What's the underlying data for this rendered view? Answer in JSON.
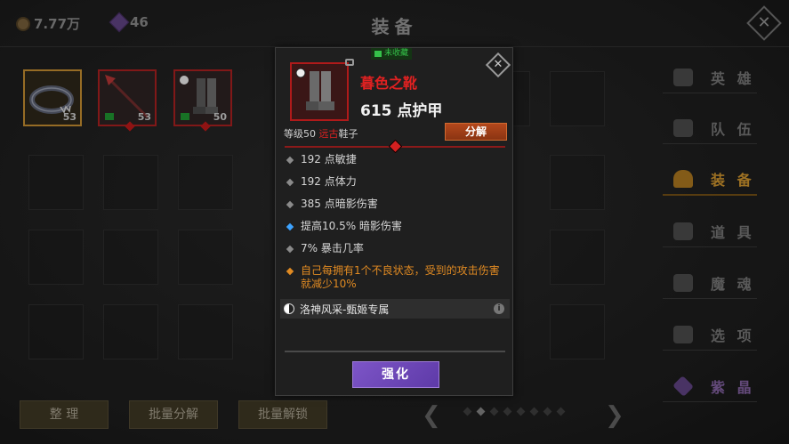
{
  "header": {
    "gold": "7.77万",
    "gems": "46",
    "title": "装备"
  },
  "inventory": {
    "items": [
      {
        "name": "dark-collar",
        "level": "53"
      },
      {
        "name": "spear",
        "level": "53"
      },
      {
        "name": "dusk-boots",
        "level": "50"
      }
    ]
  },
  "bottom_bar": {
    "sort_label": "整 理",
    "batch_salvage_label": "批量分解",
    "batch_unlock_label": "批量解锁",
    "prev_arrow": "❮",
    "next_arrow": "❯",
    "page_count": 8,
    "current_page": 2
  },
  "sidebar": {
    "items": [
      {
        "label": "英 雄",
        "icon": "hero-icon"
      },
      {
        "label": "队 伍",
        "icon": "flag-icon"
      },
      {
        "label": "装 备",
        "icon": "helmet-icon"
      },
      {
        "label": "道 具",
        "icon": "bag-icon"
      },
      {
        "label": "魔 魂",
        "icon": "flame-icon"
      },
      {
        "label": "选 项",
        "icon": "gear-icon"
      },
      {
        "label": "紫 晶",
        "icon": "crystal-icon"
      }
    ],
    "active": 2
  },
  "tooltip": {
    "uncollected_badge": "未收藏",
    "item_name": "暮色之靴",
    "armor": "615 点护甲",
    "level_text": "等级50 ",
    "quality": "远古",
    "slot_type": "鞋子",
    "salvage_label": "分解",
    "stats": [
      "192 点敏捷",
      "192 点体力",
      "385 点暗影伤害",
      "提高10.5% 暗影伤害",
      "7% 暴击几率",
      "自己每拥有1个不良状态，受到的攻击伤害就减少10%"
    ],
    "set_name": "洛神风采-甄姬专属",
    "enhance_label": "强化",
    "colors": {
      "name": "#e02121",
      "quality": "#e02121",
      "special": "#e08a22",
      "blue_bullet": "#3da3ff"
    }
  }
}
